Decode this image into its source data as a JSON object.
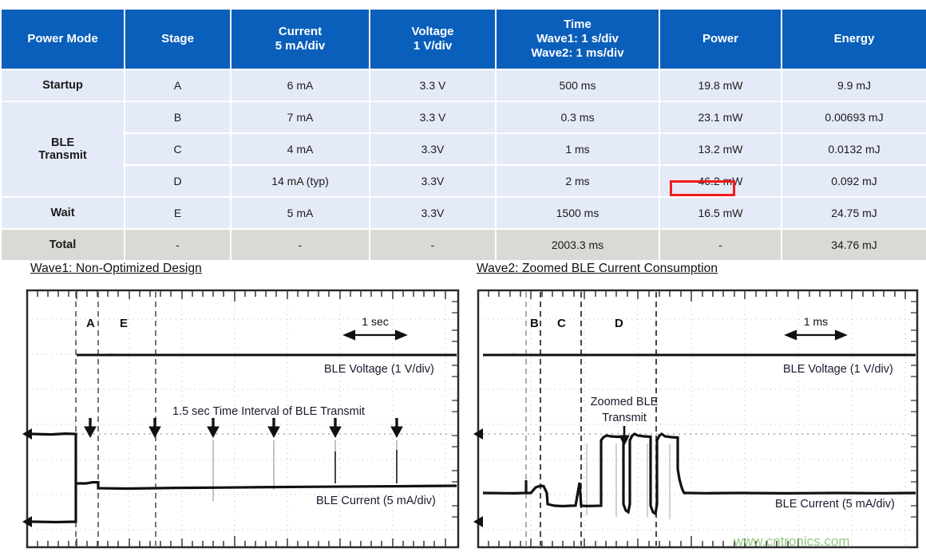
{
  "table": {
    "headers": [
      {
        "line1": "Power Mode",
        "line2": "",
        "line3": ""
      },
      {
        "line1": "Stage",
        "line2": "",
        "line3": ""
      },
      {
        "line1": "Current",
        "line2": "5 mA/div",
        "line3": ""
      },
      {
        "line1": "Voltage",
        "line2": "1 V/div",
        "line3": ""
      },
      {
        "line1": "Time",
        "line2": "Wave1: 1 s/div",
        "line3": "Wave2: 1 ms/div"
      },
      {
        "line1": "Power",
        "line2": "",
        "line3": ""
      },
      {
        "line1": "Energy",
        "line2": "",
        "line3": ""
      }
    ],
    "rows": [
      {
        "mode": "Startup",
        "mode_line2": "",
        "stage": "A",
        "current": "6 mA",
        "voltage": "3.3 V",
        "time": "500 ms",
        "power": "19.8 mW",
        "energy": "9.9 mJ"
      },
      {
        "mode": "BLE",
        "mode_line2": "Transmit",
        "stage": "B",
        "current": "7 mA",
        "voltage": "3.3 V",
        "time": "0.3 ms",
        "power": "23.1 mW",
        "energy": "0.00693 mJ"
      },
      {
        "mode": "",
        "mode_line2": "",
        "stage": "C",
        "current": "4 mA",
        "voltage": "3.3V",
        "time": "1 ms",
        "power": "13.2 mW",
        "energy": "0.0132 mJ"
      },
      {
        "mode": "",
        "mode_line2": "",
        "stage": "D",
        "current": "14 mA (typ)",
        "voltage": "3.3V",
        "time": "2 ms",
        "power": "46.2 mW",
        "energy": "0.092 mJ"
      },
      {
        "mode": "Wait",
        "mode_line2": "",
        "stage": "E",
        "current": "5 mA",
        "voltage": "3.3V",
        "time": "1500 ms",
        "power": "16.5 mW",
        "energy": "24.75 mJ"
      },
      {
        "mode": "Total",
        "mode_line2": "",
        "stage": "-",
        "current": "-",
        "voltage": "-",
        "time": "2003.3 ms",
        "power": "-",
        "energy": "34.76 mJ"
      }
    ],
    "highlight": {
      "target": "power-cell-wait",
      "color": "#f21b1b"
    },
    "colors": {
      "header_bg": "#0a5fba",
      "cell_bg": "#e4eaf7",
      "total_bg": "#d9d9d6",
      "grid": "#ffffff"
    }
  },
  "wave1": {
    "title": "Wave1: Non-Optimized Design",
    "stage_labels": [
      "A",
      "E"
    ],
    "scale_label": "1 sec",
    "voltage_label": "BLE Voltage (1 V/div)",
    "current_label": "BLE Current (5 mA/div)",
    "annotation": "1.5 sec Time Interval of BLE Transmit",
    "arrow_count": 6
  },
  "wave2": {
    "title": "Wave2: Zoomed BLE Current Consumption",
    "stage_labels": [
      "B",
      "C",
      "D"
    ],
    "scale_label": "1 ms",
    "voltage_label": "BLE Voltage (1 V/div)",
    "current_label": "BLE Current (5 mA/div)",
    "annotation_line1": "Zoomed BLE",
    "annotation_line2": "Transmit"
  },
  "watermark": {
    "text": "www.cntronics.com",
    "color": "#7fbf6a"
  }
}
